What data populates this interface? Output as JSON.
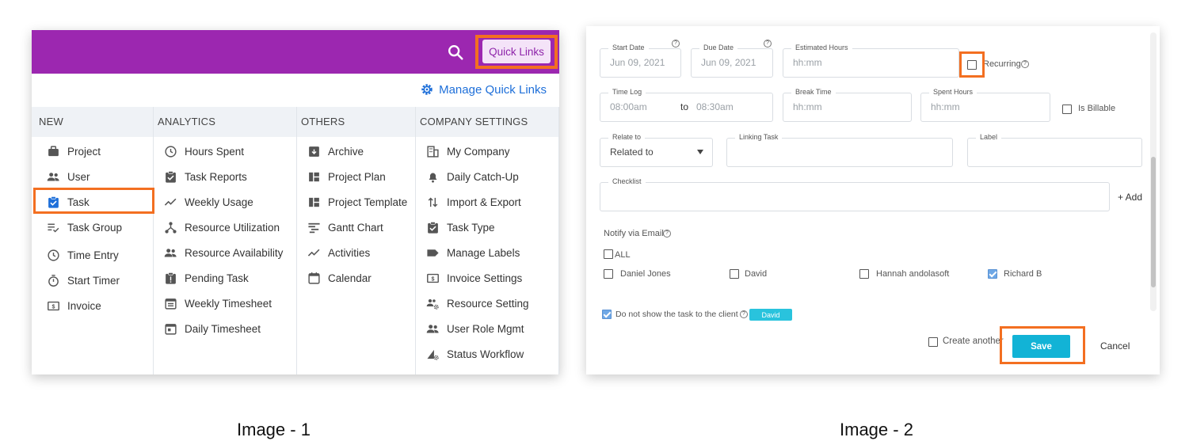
{
  "image1": {
    "quick_links_button": "Quick Links",
    "manage_quick_links": "Manage Quick Links",
    "columns": [
      {
        "title": "NEW",
        "items": [
          {
            "label": "Project",
            "icon": "briefcase-icon"
          },
          {
            "label": "User",
            "icon": "users-icon"
          },
          {
            "label": "Task",
            "icon": "clipboard-check-icon"
          },
          {
            "label": "Task Group",
            "icon": "list-check-icon"
          },
          {
            "label": "Time Entry",
            "icon": "clock-icon"
          },
          {
            "label": "Start Timer",
            "icon": "stopwatch-icon"
          },
          {
            "label": "Invoice",
            "icon": "invoice-icon"
          }
        ]
      },
      {
        "title": "ANALYTICS",
        "items": [
          {
            "label": "Hours Spent",
            "icon": "clock-icon"
          },
          {
            "label": "Task Reports",
            "icon": "clipboard-check-icon"
          },
          {
            "label": "Weekly Usage",
            "icon": "trend-line-icon"
          },
          {
            "label": "Resource Utilization",
            "icon": "hierarchy-icon"
          },
          {
            "label": "Resource Availability",
            "icon": "users-icon"
          },
          {
            "label": "Pending Task",
            "icon": "clipboard-alert-icon"
          },
          {
            "label": "Weekly Timesheet",
            "icon": "calendar-list-icon"
          },
          {
            "label": "Daily Timesheet",
            "icon": "calendar-day-icon"
          }
        ]
      },
      {
        "title": "OTHERS",
        "items": [
          {
            "label": "Archive",
            "icon": "archive-icon"
          },
          {
            "label": "Project Plan",
            "icon": "grid-plan-icon"
          },
          {
            "label": "Project Template",
            "icon": "grid-plan-icon"
          },
          {
            "label": "Gantt Chart",
            "icon": "gantt-icon"
          },
          {
            "label": "Activities",
            "icon": "trend-line-icon"
          },
          {
            "label": "Calendar",
            "icon": "calendar-icon"
          }
        ]
      },
      {
        "title": "COMPANY SETTINGS",
        "items": [
          {
            "label": "My Company",
            "icon": "building-icon"
          },
          {
            "label": "Daily Catch-Up",
            "icon": "bell-icon"
          },
          {
            "label": "Import & Export",
            "icon": "swap-arrows-icon"
          },
          {
            "label": "Task Type",
            "icon": "clipboard-check-icon"
          },
          {
            "label": "Manage Labels",
            "icon": "label-icon"
          },
          {
            "label": "Invoice Settings",
            "icon": "invoice-icon"
          },
          {
            "label": "Resource Setting",
            "icon": "users-gear-icon"
          },
          {
            "label": "User Role Mgmt",
            "icon": "users-icon"
          },
          {
            "label": "Status Workflow",
            "icon": "workflow-gear-icon"
          }
        ]
      }
    ]
  },
  "image2": {
    "start_date": {
      "label": "Start Date",
      "value": "Jun 09, 2021"
    },
    "due_date": {
      "label": "Due Date",
      "value": "Jun 09, 2021"
    },
    "estimated_hours": {
      "label": "Estimated Hours",
      "placeholder": "hh:mm"
    },
    "recurring_label": "Recurring",
    "time_log": {
      "label": "Time Log",
      "from": "08:00am",
      "to_word": "to",
      "to": "08:30am"
    },
    "break_time": {
      "label": "Break Time",
      "placeholder": "hh:mm"
    },
    "spent_hours": {
      "label": "Spent Hours",
      "placeholder": "hh:mm"
    },
    "is_billable_label": "Is Billable",
    "relate_to": {
      "label": "Relate to",
      "value": "Related to"
    },
    "linking_task_label": "Linking Task",
    "label_label": "Label",
    "checklist_label": "Checklist",
    "add_label": "+ Add",
    "notify_label": "Notify via Email",
    "notify_all": "ALL",
    "notify_users": [
      {
        "name": "Daniel Jones",
        "checked": false
      },
      {
        "name": "David",
        "checked": false
      },
      {
        "name": "Hannah andolasoft",
        "checked": false
      },
      {
        "name": "Richard B",
        "checked": true
      }
    ],
    "hide_from_client_label": "Do not show the task to the client",
    "client_badge": "David",
    "create_another_label": "Create another",
    "save_label": "Save",
    "cancel_label": "Cancel"
  },
  "captions": [
    "Image - 1",
    "Image - 2"
  ],
  "colors": {
    "topbar": "#9c27b0",
    "highlight": "#f36f21",
    "save": "#12b3d6",
    "link": "#1e6fd9"
  }
}
